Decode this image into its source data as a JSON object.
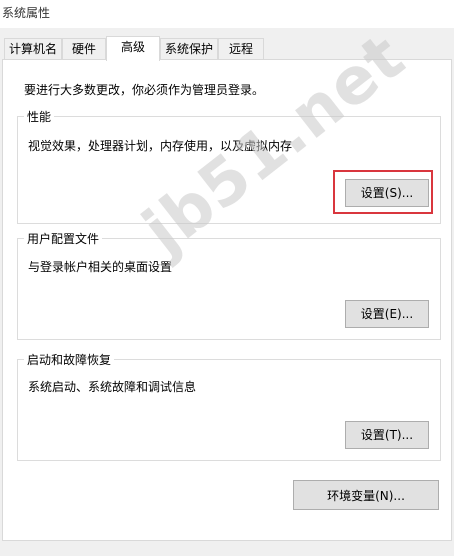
{
  "window": {
    "title": "系统属性"
  },
  "tabs": [
    {
      "label": "计算机名"
    },
    {
      "label": "硬件"
    },
    {
      "label": "高级"
    },
    {
      "label": "系统保护"
    },
    {
      "label": "远程"
    }
  ],
  "active_tab": "高级",
  "admin_note": "要进行大多数更改，你必须作为管理员登录。",
  "performance": {
    "title": "性能",
    "desc": "视觉效果，处理器计划，内存使用，以及虚拟内存",
    "button": "设置(S)..."
  },
  "user_profiles": {
    "title": "用户配置文件",
    "desc": "与登录帐户相关的桌面设置",
    "button": "设置(E)..."
  },
  "startup_recovery": {
    "title": "启动和故障恢复",
    "desc": "系统启动、系统故障和调试信息",
    "button": "设置(T)..."
  },
  "env_button": "环境变量(N)...",
  "watermark": "jb51.net",
  "colors": {
    "highlight": "#d9363e",
    "panel_bg": "#ffffff",
    "window_bg": "#f0f0f0"
  }
}
